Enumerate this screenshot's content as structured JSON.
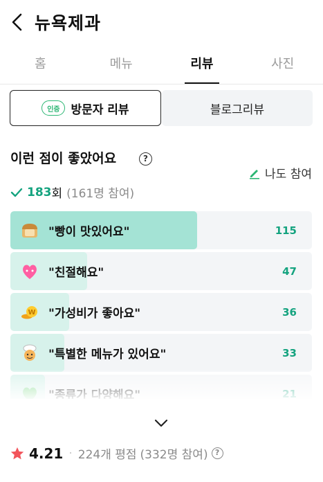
{
  "header": {
    "title": "뉴욕제과"
  },
  "tabs": [
    {
      "label": "홈"
    },
    {
      "label": "메뉴"
    },
    {
      "label": "리뷰"
    },
    {
      "label": "사진"
    }
  ],
  "segments": {
    "cert_badge": "인증",
    "visitor_label": "방문자 리뷰",
    "blog_label": "블로그리뷰"
  },
  "likes": {
    "title": "이런 점이 좋았어요",
    "help_icon": "?",
    "metoo_label": "나도 참여",
    "count": "183",
    "count_unit": "회",
    "participants": "(161명 참여)",
    "accent_color": "#14a37f",
    "bar_color": "#a4e3d5",
    "items": [
      {
        "icon": "bread-icon",
        "label": "\"빵이 맛있어요\"",
        "count": "115",
        "fill": 0.62
      },
      {
        "icon": "heart-icon",
        "label": "\"친절해요\"",
        "count": "47",
        "fill": 0.255
      },
      {
        "icon": "coin-icon",
        "label": "\"가성비가 좋아요\"",
        "count": "36",
        "fill": 0.195
      },
      {
        "icon": "chef-icon",
        "label": "\"특별한 메뉴가 있어요\"",
        "count": "33",
        "fill": 0.18
      },
      {
        "icon": "green-heart-icon",
        "label": "\"종류가 다양해요\"",
        "count": "21",
        "fill": 0.115
      }
    ]
  },
  "rating": {
    "value": "4.21",
    "separator": "·",
    "reviews": "224개 평점",
    "participants": "(332명 참여)",
    "star_color": "#f2545b"
  }
}
